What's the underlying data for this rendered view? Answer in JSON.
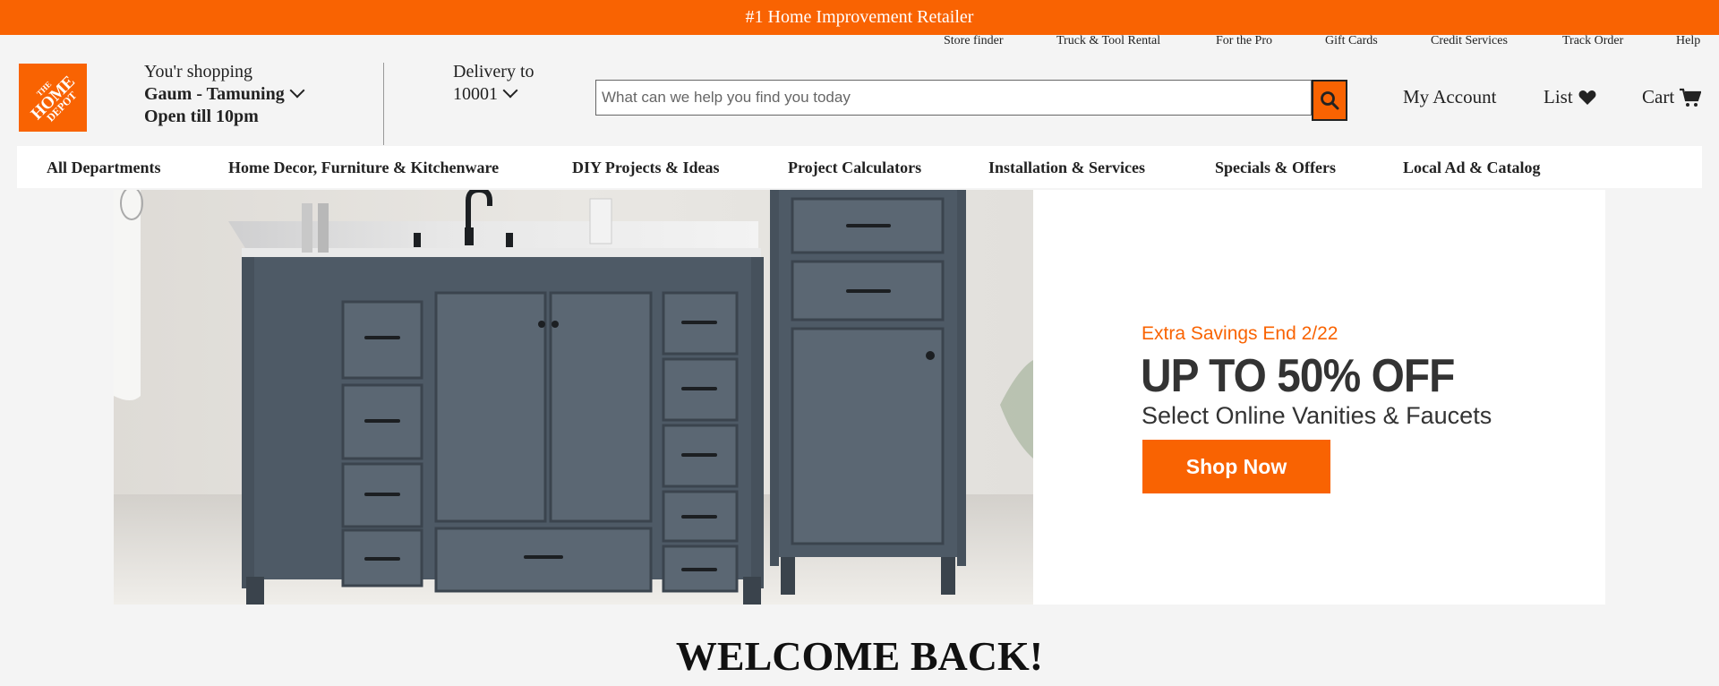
{
  "promo": {
    "text": "#1 Home Improvement Retailer"
  },
  "utility_nav": {
    "store_finder": "Store finder",
    "truck_rental": "Truck & Tool Rental",
    "for_pro": "For the Pro",
    "gift_cards": "Gift Cards",
    "credit_services": "Credit Services",
    "track_order": "Track Order",
    "help": "Help"
  },
  "logo": {
    "text": "THE HOME DEPOT"
  },
  "store": {
    "label": "You'r shopping",
    "name": "Gaum - Tamuning",
    "hours": "Open till 10pm"
  },
  "delivery": {
    "label": "Delivery to",
    "zip": "10001"
  },
  "search": {
    "placeholder": "What can we help you find you today",
    "value": ""
  },
  "header_links": {
    "account": "My Account",
    "list": "List",
    "cart": "Cart"
  },
  "main_nav": [
    "All Departments",
    "Home Decor, Furniture & Kitchenware",
    "DIY Projects & Ideas",
    "Project Calculators",
    "Installation & Services",
    "Specials & Offers",
    "Local Ad & Catalog"
  ],
  "hero": {
    "eyebrow": "Extra Savings End 2/22",
    "headline": "UP TO 50% OFF",
    "subhead": "Select Online Vanities & Faucets",
    "cta": "Shop Now"
  },
  "welcome": {
    "text": "WELCOME BACK!"
  },
  "colors": {
    "brand_orange": "#f96302",
    "vanity_blue": "#4e5a66"
  }
}
